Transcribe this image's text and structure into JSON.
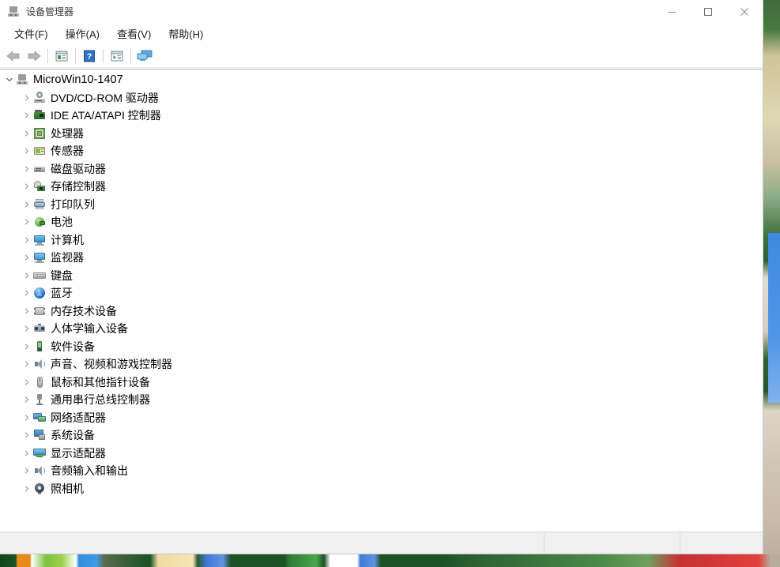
{
  "window": {
    "title": "设备管理器",
    "title_icon": "device-manager-icon"
  },
  "window_controls": {
    "minimize": "minimize-icon",
    "maximize": "maximize-icon",
    "close": "close-icon"
  },
  "menubar": {
    "items": [
      {
        "label": "文件(F)",
        "name": "menu-file"
      },
      {
        "label": "操作(A)",
        "name": "menu-action"
      },
      {
        "label": "查看(V)",
        "name": "menu-view"
      },
      {
        "label": "帮助(H)",
        "name": "menu-help"
      }
    ]
  },
  "toolbar": {
    "buttons": [
      {
        "name": "back-button",
        "icon": "back-arrow-icon"
      },
      {
        "name": "forward-button",
        "icon": "forward-arrow-icon"
      },
      {
        "name": "properties-button",
        "icon": "properties-icon"
      },
      {
        "name": "help-button",
        "icon": "help-question-icon"
      },
      {
        "name": "show-hidden-button",
        "icon": "show-hidden-devices-icon"
      },
      {
        "name": "scan-hardware-button",
        "icon": "scan-hardware-changes-icon"
      }
    ]
  },
  "tree": {
    "root": {
      "label": "MicroWin10-1407",
      "icon": "computer-icon",
      "expanded": true
    },
    "items": [
      {
        "label": "DVD/CD-ROM 驱动器",
        "icon": "dvd-drive-icon",
        "icon_class": "i-dvd"
      },
      {
        "label": "IDE ATA/ATAPI 控制器",
        "icon": "ide-controller-icon",
        "icon_class": "i-ide"
      },
      {
        "label": "处理器",
        "icon": "processor-icon",
        "icon_class": "i-cpu"
      },
      {
        "label": "传感器",
        "icon": "sensor-icon",
        "icon_class": "i-sensor"
      },
      {
        "label": "磁盘驱动器",
        "icon": "disk-drive-icon",
        "icon_class": "i-disk"
      },
      {
        "label": "存储控制器",
        "icon": "storage-controller-icon",
        "icon_class": "i-stor"
      },
      {
        "label": "打印队列",
        "icon": "print-queue-icon",
        "icon_class": "i-print"
      },
      {
        "label": "电池",
        "icon": "battery-icon",
        "icon_class": "i-batt"
      },
      {
        "label": "计算机",
        "icon": "computer-device-icon",
        "icon_class": "i-comp"
      },
      {
        "label": "监视器",
        "icon": "monitor-icon",
        "icon_class": "i-mon"
      },
      {
        "label": "键盘",
        "icon": "keyboard-icon",
        "icon_class": "i-kbd"
      },
      {
        "label": "蓝牙",
        "icon": "bluetooth-icon",
        "icon_class": "i-bt"
      },
      {
        "label": "内存技术设备",
        "icon": "memory-technology-icon",
        "icon_class": "i-mem"
      },
      {
        "label": "人体学输入设备",
        "icon": "hid-device-icon",
        "icon_class": "i-hid"
      },
      {
        "label": "软件设备",
        "icon": "software-device-icon",
        "icon_class": "i-soft"
      },
      {
        "label": "声音、视频和游戏控制器",
        "icon": "sound-video-game-icon",
        "icon_class": "i-snd"
      },
      {
        "label": "鼠标和其他指针设备",
        "icon": "mouse-icon",
        "icon_class": "i-mouse"
      },
      {
        "label": "通用串行总线控制器",
        "icon": "usb-controller-icon",
        "icon_class": "i-usb"
      },
      {
        "label": "网络适配器",
        "icon": "network-adapter-icon",
        "icon_class": "i-net"
      },
      {
        "label": "系统设备",
        "icon": "system-device-icon",
        "icon_class": "i-sys"
      },
      {
        "label": "显示适配器",
        "icon": "display-adapter-icon",
        "icon_class": "i-disp"
      },
      {
        "label": "音频输入和输出",
        "icon": "audio-io-icon",
        "icon_class": "i-aud"
      },
      {
        "label": "照相机",
        "icon": "camera-icon",
        "icon_class": "i-cam"
      }
    ]
  },
  "statusbar": {
    "main": "",
    "mid": "",
    "right": ""
  },
  "colors": {
    "window_bg": "#ffffff",
    "statusbar_bg": "#f0f0f0",
    "text": "#000000",
    "accent_blue": "#1565c0"
  }
}
